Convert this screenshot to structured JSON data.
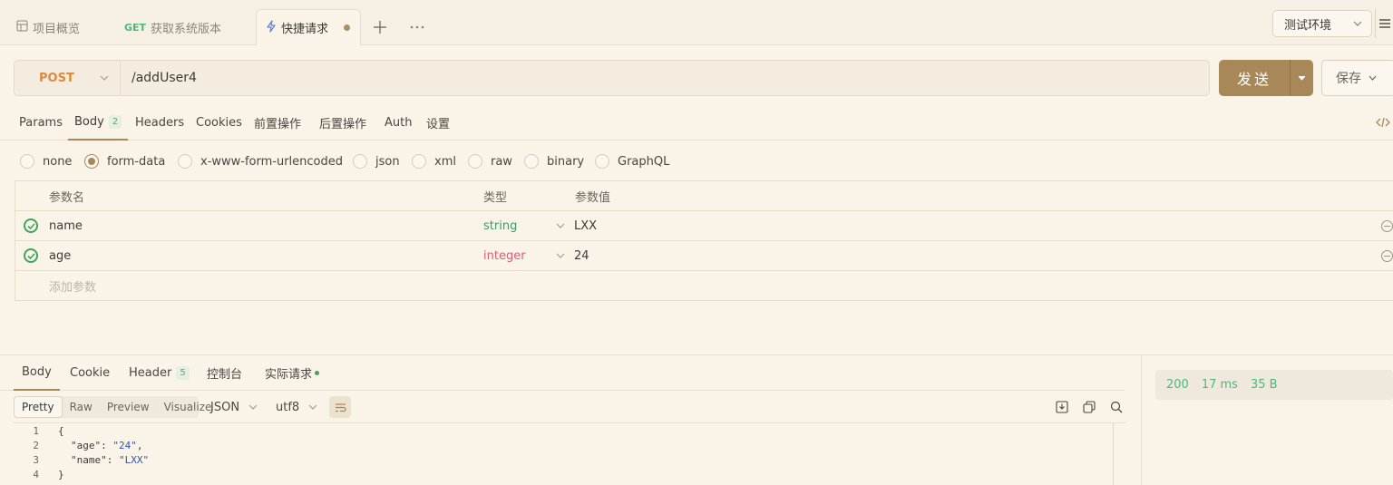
{
  "tabs": [
    {
      "label": "项目概览"
    },
    {
      "method": "GET",
      "label": "获取系统版本"
    },
    {
      "label": "快捷请求"
    }
  ],
  "env": {
    "label": "测试环境"
  },
  "request": {
    "method": "POST",
    "url": "/addUser4"
  },
  "buttons": {
    "send": "发送",
    "save": "保存"
  },
  "req_tabs": [
    {
      "label": "Params"
    },
    {
      "label": "Body",
      "badge": "2"
    },
    {
      "label": "Headers"
    },
    {
      "label": "Cookies"
    },
    {
      "label": "前置操作"
    },
    {
      "label": "后置操作"
    },
    {
      "label": "Auth"
    },
    {
      "label": "设置"
    }
  ],
  "body_types": [
    "none",
    "form-data",
    "x-www-form-urlencoded",
    "json",
    "xml",
    "raw",
    "binary",
    "GraphQL"
  ],
  "params": {
    "headers": {
      "name": "参数名",
      "type": "类型",
      "value": "参数值"
    },
    "rows": [
      {
        "name": "name",
        "type": "string",
        "value": "LXX"
      },
      {
        "name": "age",
        "type": "integer",
        "value": "24"
      }
    ],
    "add_placeholder": "添加参数"
  },
  "resp_tabs": [
    {
      "label": "Body"
    },
    {
      "label": "Cookie"
    },
    {
      "label": "Header",
      "badge": "5"
    },
    {
      "label": "控制台"
    },
    {
      "label": "实际请求"
    }
  ],
  "format_modes": [
    "Pretty",
    "Raw",
    "Preview",
    "Visualize"
  ],
  "format_select": "JSON",
  "encoding_select": "utf8",
  "status": {
    "code": "200",
    "time": "17 ms",
    "size": "35 B"
  },
  "code_lines": [
    {
      "num": "1",
      "text": "{"
    },
    {
      "num": "2",
      "key": "\"age\"",
      "val": "\"24\"",
      "tail": ","
    },
    {
      "num": "3",
      "key": "\"name\"",
      "val": "\"LXX\"",
      "tail": ""
    },
    {
      "num": "4",
      "text": "}"
    }
  ],
  "colors": {
    "accent": "#a88758",
    "method_post": "#e0893a",
    "method_get": "#4db87a",
    "type_string": "#3f9a6a",
    "type_integer": "#e05a78",
    "status_ok": "#4db87a"
  }
}
